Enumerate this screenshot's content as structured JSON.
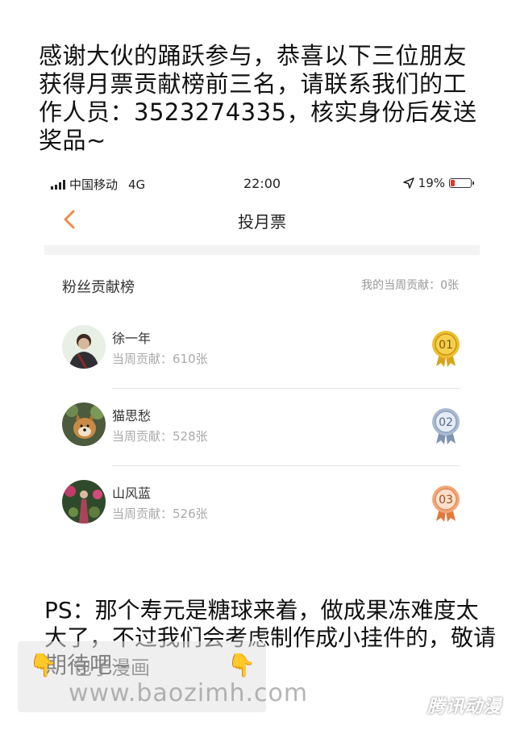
{
  "announcement": {
    "headline": "感谢大伙的踊跃参与，恭喜以下三位朋友获得月票贡献榜前三名，请联系我们的工作人员：3523274335，核实身份后发送奖品~"
  },
  "statusbar": {
    "carrier": "中国移动",
    "network": "4G",
    "time": "22:00",
    "battery": "19%",
    "icons": [
      "signal-icon",
      "location-arrow-icon",
      "battery-icon"
    ],
    "battery_color": "#e0352b"
  },
  "nav": {
    "title": "投月票",
    "back_icon": "chevron-left-icon",
    "accent": "#f08a4b"
  },
  "leaderboard": {
    "title": "粉丝贡献榜",
    "my_contribution": "我的当周贡献：0张",
    "rows": [
      {
        "name": "徐一年",
        "contribution": "当周贡献：610张",
        "rank": "01",
        "medal": "gold-medal-icon",
        "medal_color": "#e8b020"
      },
      {
        "name": "猫思愁",
        "contribution": "当周贡献：528张",
        "rank": "02",
        "medal": "silver-medal-icon",
        "medal_color": "#8fa3c0"
      },
      {
        "name": "山风蓝",
        "contribution": "当周贡献：526张",
        "rank": "03",
        "medal": "bronze-medal-icon",
        "medal_color": "#eb8a55"
      }
    ]
  },
  "ps": {
    "text": "PS：那个寿元是糖球来着，做成果冻难度太大了，不过我们会考虑制作成小挂件的，敬请期待吧~"
  },
  "watermark": {
    "title": "包子漫画",
    "url": "www.baozimh.com",
    "corner_logo": "腾讯动漫"
  }
}
